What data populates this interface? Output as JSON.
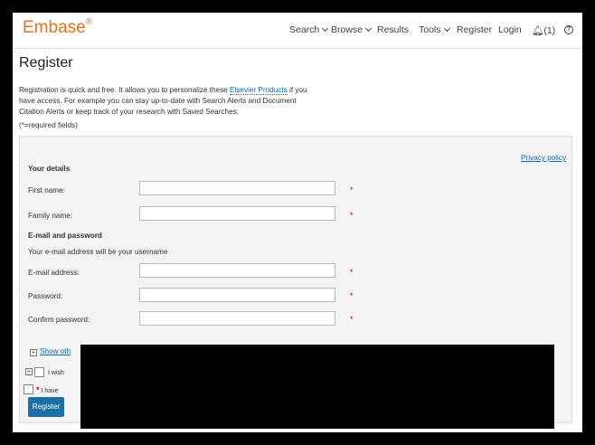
{
  "header": {
    "logo": "Embase",
    "logo_mark": "®",
    "nav": {
      "search": "Search",
      "browse": "Browse",
      "results": "Results",
      "tools": "Tools",
      "register": "Register",
      "login": "Login",
      "notifications": "(1)"
    },
    "help": "?"
  },
  "page": {
    "title": "Register",
    "intro_part1": "Registration is quick and free. It allows you to personalize these ",
    "intro_link": "Elsevier Products",
    "intro_part2": " if you have access. For example you can stay up-to-date with Search Alerts and Document Citation Alerts or keep track of your research with Saved Searches.",
    "required_open": "(",
    "required_star": "*",
    "required_rest": "=required fields)"
  },
  "form": {
    "privacy_link": "Privacy policy",
    "your_details_title": "Your details",
    "first_name_label": "First name:",
    "family_name_label": "Family name:",
    "email_password_title": "E-mail and password",
    "email_hint": "Your e-mail address will be your username",
    "email_label": "E-mail address:",
    "password_label": "Password:",
    "confirm_password_label": "Confirm password:",
    "required_marker": "*",
    "show_other_text": "Show oth",
    "checkbox1_text": "I wish",
    "checkbox2_text": "I have",
    "register_button": "Register"
  },
  "icons": {
    "notifications": "bell-icon",
    "help": "question-circle-icon",
    "nav_dropdown": "chevron-down-icon",
    "expander": "plus-square-icon"
  },
  "colors": {
    "brand": "#e9711c",
    "link": "#0c6db0",
    "button": "#1d6fa5",
    "required": "#d0021b"
  }
}
